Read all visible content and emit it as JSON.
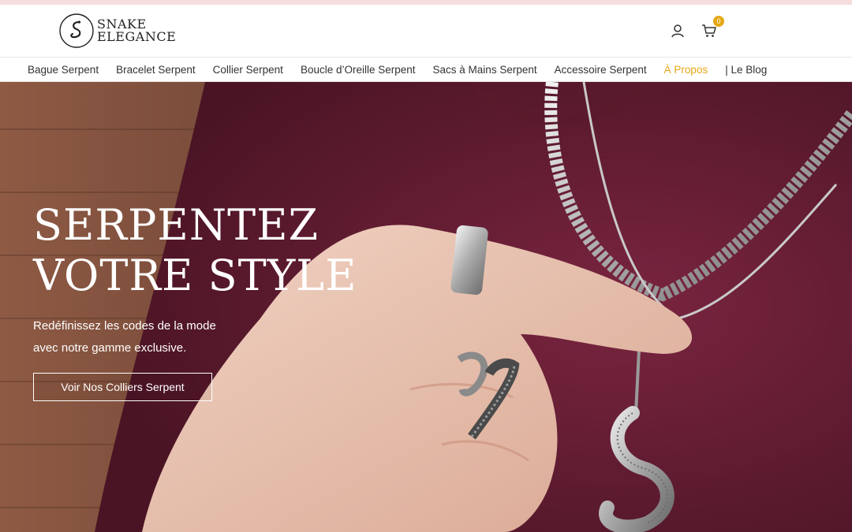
{
  "brand": {
    "line1": "SNAKE",
    "line2": "ELEGANCE"
  },
  "header": {
    "cart_count": "0"
  },
  "nav": {
    "items": [
      {
        "label": "Bague Serpent"
      },
      {
        "label": "Bracelet Serpent"
      },
      {
        "label": "Collier Serpent"
      },
      {
        "label": "Boucle d’Oreille Serpent"
      },
      {
        "label": "Sacs à Mains Serpent"
      },
      {
        "label": "Accessoire Serpent"
      },
      {
        "label": "À Propos"
      },
      {
        "label": "| Le Blog"
      }
    ]
  },
  "hero": {
    "title_line1": "SERPENTEZ",
    "title_line2": "VOTRE STYLE",
    "subtitle_line1": "Redéfinissez les codes de la mode",
    "subtitle_line2": "avec notre gamme exclusive.",
    "cta": "Voir Nos Colliers Serpent"
  },
  "colors": {
    "accent": "#e6a817",
    "shirt": "#6a1e33",
    "topbar": "#f6dcdc"
  }
}
